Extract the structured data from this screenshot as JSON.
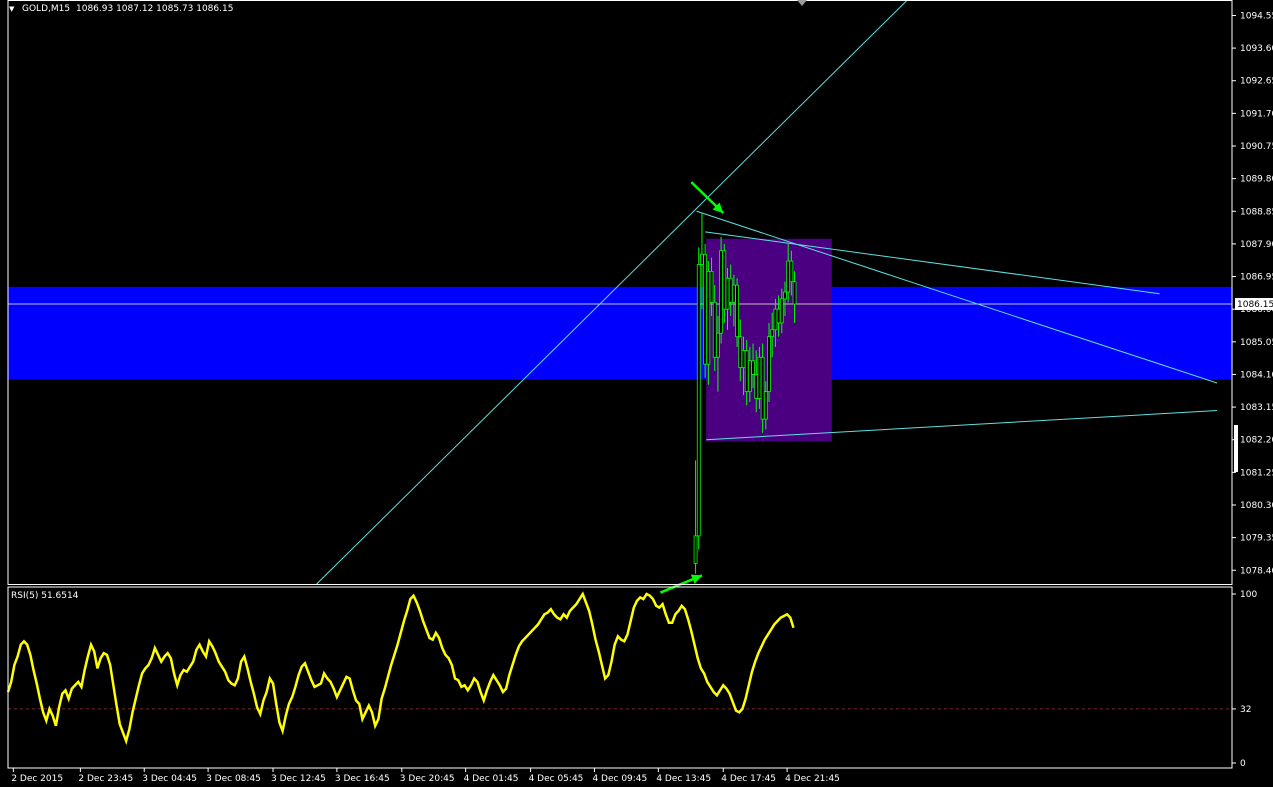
{
  "header": {
    "dropdown_glyph": "▼",
    "symbol": "GOLD,M15",
    "ohlc": "1086.93 1087.12 1085.73 1086.15"
  },
  "rsi_header": "RSI(5) 51.6514",
  "colors": {
    "background": "#000000",
    "grid": "#ffffff",
    "candle": "#00ff00",
    "zone": "#0000ff",
    "rect": "#4b0082",
    "trend": "#5fe0e0",
    "rsi": "#ffff00",
    "rsi_level": "#7a2a2a",
    "arrow": "#00ff00"
  },
  "chart_data": [
    {
      "type": "candlestick",
      "ylim": [
        1078.0,
        1095.0
      ],
      "y_ticks": [
        "1094.55",
        "1093.60",
        "1092.65",
        "1091.70",
        "1090.75",
        "1089.80",
        "1088.85",
        "1087.90",
        "1086.95",
        "1086.00",
        "1085.05",
        "1084.10",
        "1083.15",
        "1082.20",
        "1081.25",
        "1080.30",
        "1079.35",
        "1078.40"
      ],
      "current_price": "1086.15",
      "x_labels": [
        "2 Dec 2015",
        "2 Dec 23:45",
        "3 Dec 04:45",
        "3 Dec 08:45",
        "3 Dec 12:45",
        "3 Dec 16:45",
        "3 Dec 20:45",
        "4 Dec 01:45",
        "4 Dec 05:45",
        "4 Dec 09:45",
        "4 Dec 13:45",
        "4 Dec 17:45",
        "4 Dec 21:45"
      ],
      "x_label_positions": [
        0.5,
        6.8,
        12.8,
        18.8,
        24.9,
        30.9,
        37.0,
        43.0,
        49.1,
        55.1,
        61.1,
        67.2,
        73.2
      ],
      "x_range": [
        0,
        115
      ],
      "candles": [
        {
          "x": 64.6,
          "o": 1078.6,
          "h": 1081.6,
          "l": 1078.3,
          "c": 1079.4
        },
        {
          "x": 64.9,
          "o": 1079.4,
          "h": 1087.8,
          "l": 1079.0,
          "c": 1087.3
        },
        {
          "x": 65.2,
          "o": 1087.3,
          "h": 1088.8,
          "l": 1086.0,
          "c": 1087.6
        },
        {
          "x": 65.5,
          "o": 1087.6,
          "h": 1087.9,
          "l": 1084.0,
          "c": 1084.4
        },
        {
          "x": 65.8,
          "o": 1084.4,
          "h": 1087.4,
          "l": 1083.8,
          "c": 1087.1
        },
        {
          "x": 66.1,
          "o": 1087.1,
          "h": 1087.5,
          "l": 1085.8,
          "c": 1086.2
        },
        {
          "x": 66.4,
          "o": 1086.2,
          "h": 1086.7,
          "l": 1084.2,
          "c": 1084.6
        },
        {
          "x": 66.7,
          "o": 1084.6,
          "h": 1085.8,
          "l": 1083.6,
          "c": 1085.3
        },
        {
          "x": 67.0,
          "o": 1085.3,
          "h": 1088.1,
          "l": 1085.0,
          "c": 1087.7
        },
        {
          "x": 67.3,
          "o": 1087.7,
          "h": 1087.9,
          "l": 1085.6,
          "c": 1086.0
        },
        {
          "x": 67.6,
          "o": 1086.0,
          "h": 1087.2,
          "l": 1085.4,
          "c": 1086.9
        },
        {
          "x": 67.9,
          "o": 1086.9,
          "h": 1087.3,
          "l": 1085.8,
          "c": 1086.2
        },
        {
          "x": 68.2,
          "o": 1086.2,
          "h": 1087.0,
          "l": 1085.5,
          "c": 1086.7
        },
        {
          "x": 68.5,
          "o": 1086.7,
          "h": 1086.9,
          "l": 1084.9,
          "c": 1085.2
        },
        {
          "x": 68.8,
          "o": 1085.2,
          "h": 1085.7,
          "l": 1083.9,
          "c": 1084.3
        },
        {
          "x": 69.1,
          "o": 1084.3,
          "h": 1085.2,
          "l": 1083.5,
          "c": 1084.8
        },
        {
          "x": 69.4,
          "o": 1084.8,
          "h": 1085.1,
          "l": 1083.2,
          "c": 1083.6
        },
        {
          "x": 69.7,
          "o": 1083.6,
          "h": 1084.9,
          "l": 1083.3,
          "c": 1084.5
        },
        {
          "x": 70.0,
          "o": 1084.5,
          "h": 1085.0,
          "l": 1083.7,
          "c": 1084.1
        },
        {
          "x": 70.3,
          "o": 1084.1,
          "h": 1084.8,
          "l": 1083.0,
          "c": 1083.4
        },
        {
          "x": 70.6,
          "o": 1083.4,
          "h": 1084.9,
          "l": 1083.1,
          "c": 1084.6
        },
        {
          "x": 70.9,
          "o": 1084.6,
          "h": 1085.0,
          "l": 1082.4,
          "c": 1082.8
        },
        {
          "x": 71.2,
          "o": 1082.8,
          "h": 1083.9,
          "l": 1082.5,
          "c": 1083.6
        },
        {
          "x": 71.5,
          "o": 1083.6,
          "h": 1085.6,
          "l": 1083.3,
          "c": 1085.2
        },
        {
          "x": 71.8,
          "o": 1085.2,
          "h": 1085.9,
          "l": 1084.6,
          "c": 1085.4
        },
        {
          "x": 72.1,
          "o": 1085.4,
          "h": 1086.3,
          "l": 1084.9,
          "c": 1086.0
        },
        {
          "x": 72.4,
          "o": 1086.0,
          "h": 1086.4,
          "l": 1085.2,
          "c": 1085.6
        },
        {
          "x": 72.7,
          "o": 1085.6,
          "h": 1086.6,
          "l": 1085.3,
          "c": 1086.3
        },
        {
          "x": 73.0,
          "o": 1086.3,
          "h": 1086.8,
          "l": 1085.8,
          "c": 1086.5
        },
        {
          "x": 73.3,
          "o": 1086.5,
          "h": 1087.9,
          "l": 1086.2,
          "c": 1087.4
        },
        {
          "x": 73.6,
          "o": 1087.4,
          "h": 1087.7,
          "l": 1086.4,
          "c": 1086.8
        },
        {
          "x": 73.9,
          "o": 1086.8,
          "h": 1087.1,
          "l": 1085.6,
          "c": 1086.15
        }
      ],
      "zone": {
        "from": 1083.95,
        "to": 1086.65
      },
      "rect": {
        "x0": 65.6,
        "x1": 77.4,
        "y0": 1082.15,
        "y1": 1088.05
      },
      "trendlines": [
        {
          "x0": 29.0,
          "y0": 1078.0,
          "x1": 84.5,
          "y1": 1095.0
        },
        {
          "x0": 64.7,
          "y0": 1088.85,
          "x1": 113.6,
          "y1": 1083.85
        },
        {
          "x0": 65.5,
          "y0": 1088.25,
          "x1": 108.2,
          "y1": 1086.45
        },
        {
          "x0": 65.6,
          "y0": 1082.2,
          "x1": 113.6,
          "y1": 1083.05
        }
      ],
      "arrows": [
        {
          "x0": 64.2,
          "y0": 1089.7,
          "x1": 67.2,
          "y1": 1088.8
        },
        {
          "x0": 61.3,
          "y0": 1077.75,
          "x1": 65.2,
          "y1": 1078.25
        }
      ]
    },
    {
      "type": "line",
      "name": "RSI(5)",
      "ylim": [
        0,
        100
      ],
      "y_ticks": [
        "100",
        "32",
        "0"
      ],
      "level": 32,
      "x": [
        0.0,
        0.3,
        0.6,
        0.9,
        1.2,
        1.5,
        1.8,
        2.1,
        2.4,
        2.7,
        3.0,
        3.3,
        3.6,
        3.9,
        4.2,
        4.5,
        4.8,
        5.1,
        5.4,
        5.7,
        6.0,
        6.3,
        6.6,
        6.9,
        7.2,
        7.5,
        7.8,
        8.1,
        8.4,
        8.7,
        9.0,
        9.3,
        9.6,
        9.9,
        10.2,
        10.5,
        10.8,
        11.1,
        11.4,
        11.7,
        12.0,
        12.3,
        12.6,
        12.9,
        13.2,
        13.5,
        13.8,
        14.1,
        14.4,
        14.7,
        15.0,
        15.3,
        15.6,
        15.9,
        16.2,
        16.5,
        16.8,
        17.1,
        17.4,
        17.7,
        18.0,
        18.3,
        18.6,
        18.9,
        19.2,
        19.5,
        19.8,
        20.1,
        20.4,
        20.7,
        21.0,
        21.3,
        21.6,
        21.9,
        22.2,
        22.5,
        22.8,
        23.1,
        23.4,
        23.7,
        24.0,
        24.3,
        24.6,
        24.9,
        25.2,
        25.5,
        25.8,
        26.1,
        26.4,
        26.7,
        27.0,
        27.3,
        27.6,
        27.9,
        28.2,
        28.5,
        28.8,
        29.1,
        29.4,
        29.7,
        30.0,
        30.3,
        30.6,
        30.9,
        31.2,
        31.5,
        31.8,
        32.1,
        32.4,
        32.7,
        33.0,
        33.3,
        33.6,
        33.9,
        34.2,
        34.5,
        34.8,
        35.1,
        35.4,
        35.7,
        36.0,
        36.3,
        36.6,
        36.9,
        37.2,
        37.5,
        37.8,
        38.1,
        38.4,
        38.7,
        39.0,
        39.3,
        39.6,
        39.9,
        40.2,
        40.5,
        40.8,
        41.1,
        41.4,
        41.7,
        42.0,
        42.3,
        42.6,
        42.9,
        43.2,
        43.5,
        43.8,
        44.1,
        44.4,
        44.7,
        45.0,
        45.3,
        45.6,
        45.9,
        46.2,
        46.5,
        46.8,
        47.1,
        47.4,
        47.7,
        48.0,
        48.3,
        48.6,
        48.9,
        49.2,
        49.5,
        49.8,
        50.1,
        50.4,
        50.7,
        51.0,
        51.3,
        51.6,
        51.9,
        52.2,
        52.5,
        52.8,
        53.1,
        53.4,
        53.7,
        54.0,
        54.3,
        54.6,
        54.9,
        55.2,
        55.5,
        55.8,
        56.1,
        56.4,
        56.7,
        57.0,
        57.3,
        57.6,
        57.9,
        58.2,
        58.5,
        58.8,
        59.1,
        59.4,
        59.7,
        60.0,
        60.3,
        60.6,
        60.9,
        61.2,
        61.5,
        61.8,
        62.1,
        62.4,
        62.7,
        63.0,
        63.3,
        63.6,
        63.9,
        64.2,
        64.5,
        64.8,
        65.1,
        65.4,
        65.7,
        66.0,
        66.3,
        66.6,
        66.9,
        67.2,
        67.5,
        67.8,
        68.1,
        68.4,
        68.7,
        69.0,
        69.3,
        69.6,
        69.9,
        70.2,
        70.5,
        70.8,
        71.1,
        71.4,
        71.7,
        72.0,
        72.3,
        72.6,
        72.9,
        73.2,
        73.5,
        73.8
      ],
      "values": [
        42,
        48,
        58,
        63,
        70,
        72,
        70,
        64,
        55,
        47,
        38,
        30,
        25,
        32,
        28,
        22,
        33,
        41,
        43,
        38,
        44,
        46,
        48,
        45,
        55,
        63,
        70,
        66,
        56,
        62,
        65,
        64,
        58,
        46,
        34,
        23,
        18,
        13,
        20,
        30,
        38,
        46,
        53,
        56,
        58,
        62,
        68,
        64,
        60,
        63,
        65,
        62,
        53,
        46,
        52,
        55,
        54,
        57,
        60,
        67,
        70,
        66,
        63,
        72,
        69,
        65,
        60,
        57,
        54,
        49,
        47,
        46,
        50,
        60,
        63,
        56,
        48,
        41,
        33,
        29,
        37,
        42,
        50,
        47,
        35,
        24,
        19,
        28,
        35,
        39,
        45,
        52,
        57,
        59,
        54,
        49,
        45,
        46,
        47,
        53,
        50,
        48,
        44,
        39,
        43,
        47,
        51,
        50,
        43,
        37,
        35,
        26,
        30,
        34,
        30,
        22,
        26,
        38,
        44,
        51,
        58,
        64,
        70,
        77,
        84,
        90,
        97,
        99,
        95,
        90,
        84,
        79,
        74,
        73,
        77,
        74,
        68,
        64,
        62,
        58,
        50,
        49,
        45,
        46,
        43,
        46,
        50,
        48,
        42,
        37,
        43,
        48,
        52,
        49,
        46,
        42,
        44,
        52,
        58,
        64,
        69,
        72,
        74,
        76,
        78,
        80,
        82,
        85,
        88,
        89,
        91,
        88,
        86,
        85,
        88,
        86,
        90,
        92,
        94,
        97,
        100,
        95,
        90,
        82,
        73,
        66,
        58,
        50,
        52,
        60,
        70,
        75,
        73,
        72,
        76,
        84,
        92,
        96,
        98,
        97,
        100,
        99,
        97,
        93,
        92,
        94,
        88,
        83,
        83,
        88,
        90,
        93,
        91,
        85,
        78,
        70,
        62,
        56,
        53,
        48,
        45,
        42,
        40,
        43,
        46,
        44,
        41,
        36,
        31,
        30,
        32,
        38,
        46,
        54,
        60,
        65,
        69,
        73,
        76,
        79,
        82,
        84,
        86,
        87,
        88,
        86,
        80,
        70
      ]
    }
  ]
}
